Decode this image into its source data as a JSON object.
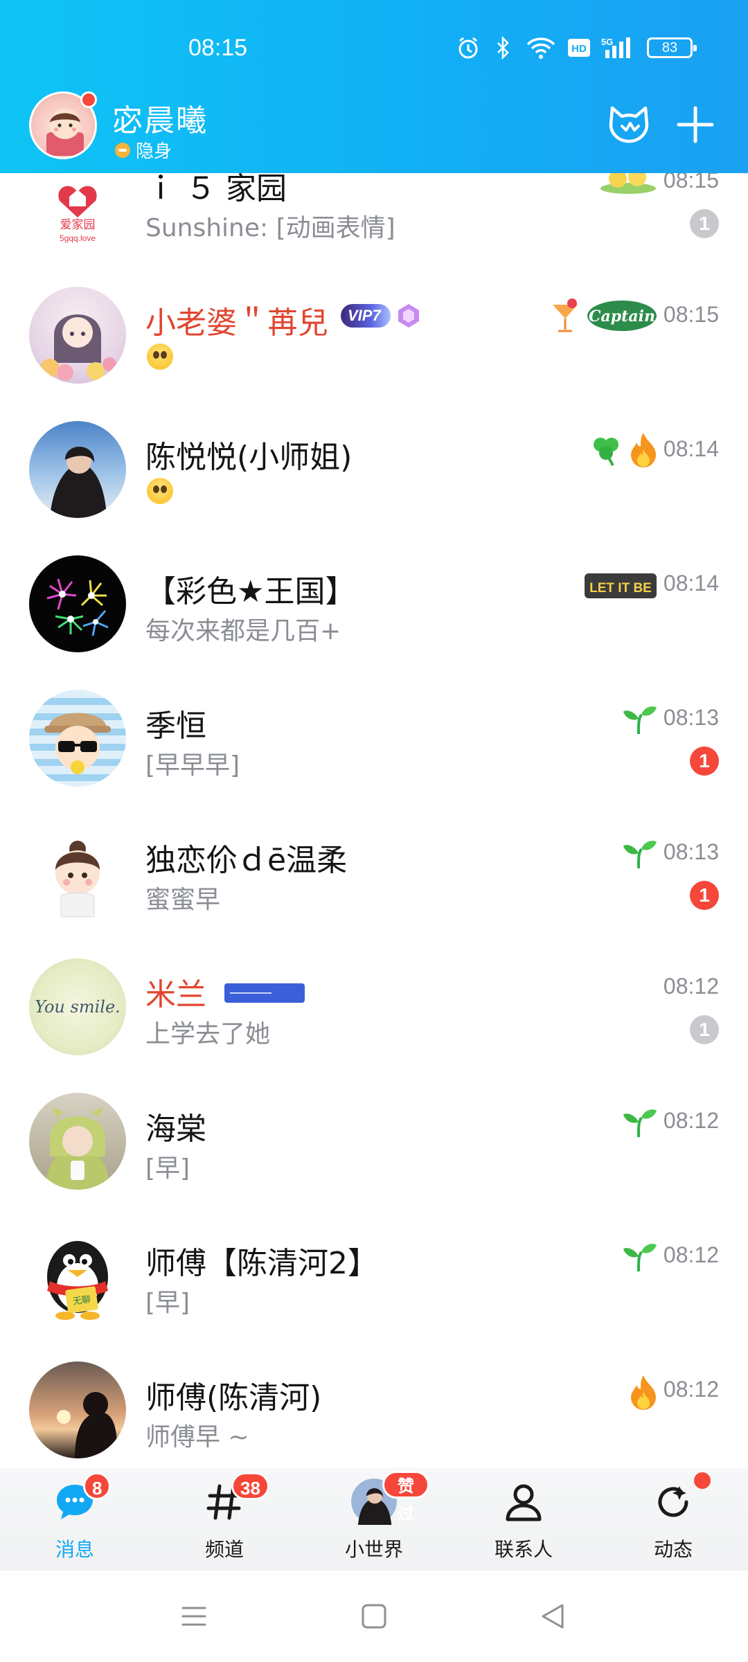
{
  "status_bar": {
    "time": "08:15",
    "icons": [
      "alarm-icon",
      "bluetooth-icon",
      "wifi-icon",
      "hd-icon",
      "5g-signal-icon",
      "battery-icon"
    ],
    "hd_label": "HD",
    "network_label": "5G",
    "battery": "83"
  },
  "header": {
    "name": "宓晨曦",
    "status": "隐身",
    "accent": "#12aef5"
  },
  "conversations": [
    {
      "title": "ｉ ５ 家园",
      "preview": "Sunshine: [动画表情]",
      "time": "08:15",
      "badge": "1",
      "avatar_text": "爱家园",
      "avatar_sub": "5gqq.love"
    },
    {
      "title": "小老婆＂苒兒",
      "preview": "",
      "time": "08:15",
      "badge": "",
      "vip": "VIP7",
      "deco_text": "Captain"
    },
    {
      "title": "陈悦悦(小师姐)",
      "preview": "",
      "time": "08:14",
      "badge": ""
    },
    {
      "title": "【彩色★王国】",
      "preview": "每次来都是几百+",
      "time": "08:14",
      "badge": "",
      "deco_text": "LET IT BE"
    },
    {
      "title": "季恒",
      "preview": "[早早早]",
      "time": "08:13",
      "badge": "1"
    },
    {
      "title": "独恋伱ｄē温柔",
      "preview": "蜜蜜早",
      "time": "08:13",
      "badge": "1"
    },
    {
      "title": "米兰",
      "preview": "上学去了她",
      "time": "08:12",
      "badge": "1",
      "avatar_text": "You smile."
    },
    {
      "title": "海棠",
      "preview": "[早]",
      "time": "08:12",
      "badge": ""
    },
    {
      "title": "师傅【陈清河2】",
      "preview": "[早]",
      "time": "08:12",
      "badge": "",
      "avatar_text": "无聊"
    },
    {
      "title": "师傅(陈清河)",
      "preview": "师傅早 ~",
      "time": "08:12",
      "badge": ""
    }
  ],
  "tabs": [
    {
      "label": "消息",
      "badge": "8",
      "icon": "message-bubble-icon",
      "active": true
    },
    {
      "label": "频道",
      "badge": "38",
      "icon": "hashtag-icon"
    },
    {
      "label": "小世界",
      "badge": "赞过",
      "icon": "avatar-icon"
    },
    {
      "label": "联系人",
      "badge": "",
      "icon": "person-icon"
    },
    {
      "label": "动态",
      "badge": "",
      "icon": "refresh-star-icon"
    }
  ],
  "system_nav": [
    "menu-icon",
    "home-icon",
    "back-icon"
  ]
}
